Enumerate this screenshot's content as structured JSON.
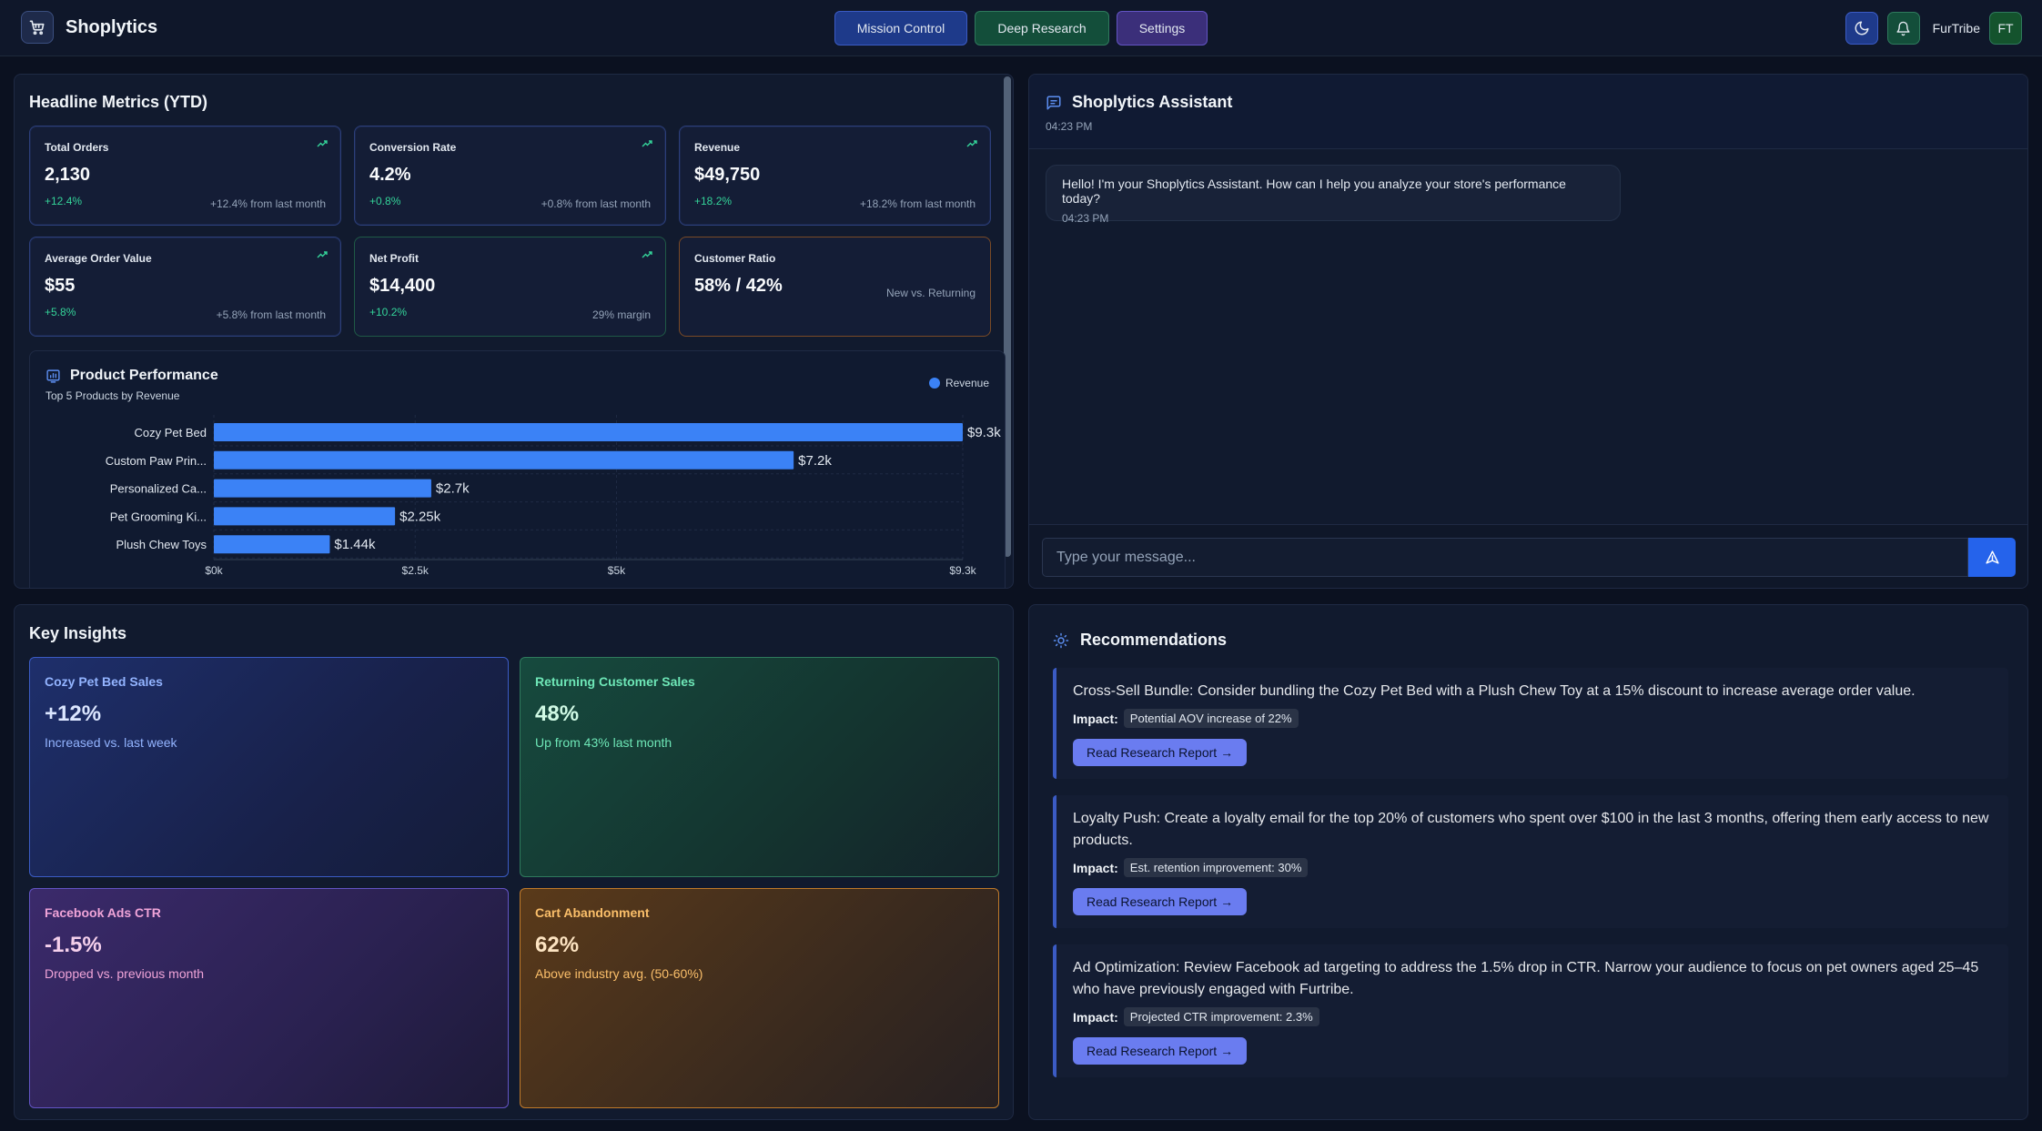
{
  "app": {
    "name": "Shoplytics",
    "nav": [
      "Mission Control",
      "Deep Research",
      "Settings"
    ],
    "user_name": "FurTribe",
    "user_initials": "FT"
  },
  "metrics": {
    "title": "Headline Metrics (YTD)",
    "cards": [
      {
        "label": "Total Orders",
        "value": "2,130",
        "delta": "+12.4%",
        "note": "+12.4% from last month"
      },
      {
        "label": "Conversion Rate",
        "value": "4.2%",
        "delta": "+0.8%",
        "note": "+0.8% from last month"
      },
      {
        "label": "Revenue",
        "value": "$49,750",
        "delta": "+18.2%",
        "note": "+18.2% from last month"
      },
      {
        "label": "Average Order Value",
        "value": "$55",
        "delta": "+5.8%",
        "note": "+5.8% from last month"
      },
      {
        "label": "Net Profit",
        "value": "$14,400",
        "delta": "+10.2%",
        "note": "29% margin"
      },
      {
        "label": "Customer Ratio",
        "value": "58% / 42%",
        "delta": "",
        "note": "New vs. Returning"
      }
    ]
  },
  "product_performance": {
    "title": "Product Performance",
    "subtitle": "Top 5 Products by Revenue",
    "legend": "Revenue"
  },
  "chart_data": {
    "type": "bar",
    "orientation": "horizontal",
    "title": "Product Performance",
    "subtitle": "Top 5 Products by Revenue",
    "categories": [
      "Cozy Pet Bed",
      "Custom Paw Prin...",
      "Personalized Ca...",
      "Pet Grooming Ki...",
      "Plush Chew Toys"
    ],
    "series": [
      {
        "name": "Revenue",
        "values": [
          9300,
          7200,
          2700,
          2250,
          1440
        ]
      }
    ],
    "value_labels": [
      "$9.3k",
      "$7.2k",
      "$2.7k",
      "$2.25k",
      "$1.44k"
    ],
    "x_ticks": [
      0,
      2500,
      5000,
      9300
    ],
    "x_tick_labels": [
      "$0k",
      "$2.5k",
      "$5k",
      "$9.3k"
    ],
    "xlim": [
      0,
      9300
    ],
    "legend_position": "top-right",
    "grid": true,
    "bar_color": "#3b82f6"
  },
  "assistant": {
    "title": "Shoplytics Assistant",
    "time": "04:23 PM",
    "message": "Hello! I'm your Shoplytics Assistant. How can I help you analyze your store's performance today?",
    "message_time": "04:23 PM",
    "input_placeholder": "Type your message..."
  },
  "insights": {
    "title": "Key Insights",
    "cards": [
      {
        "label": "Cozy Pet Bed Sales",
        "value": "+12%",
        "sub": "Increased vs. last week"
      },
      {
        "label": "Returning Customer Sales",
        "value": "48%",
        "sub": "Up from 43% last month"
      },
      {
        "label": "Facebook Ads CTR",
        "value": "-1.5%",
        "sub": "Dropped vs. previous month"
      },
      {
        "label": "Cart Abandonment",
        "value": "62%",
        "sub": "Above industry avg. (50-60%)"
      }
    ]
  },
  "recommendations": {
    "title": "Recommendations",
    "impact_label": "Impact:",
    "button_label": "Read Research Report →",
    "items": [
      {
        "text": "Cross-Sell Bundle: Consider bundling the Cozy Pet Bed with a Plush Chew Toy at a 15% discount to increase average order value.",
        "impact": "Potential AOV increase of 22%"
      },
      {
        "text": "Loyalty Push: Create a loyalty email for the top 20% of customers who spent over $100 in the last 3 months, offering them early access to new products.",
        "impact": "Est. retention improvement: 30%"
      },
      {
        "text": "Ad Optimization: Review Facebook ad targeting to address the 1.5% drop in CTR. Narrow your audience to focus on pet owners aged 25–45 who have previously engaged with Furtribe.",
        "impact": "Projected CTR improvement: 2.3%"
      }
    ]
  }
}
